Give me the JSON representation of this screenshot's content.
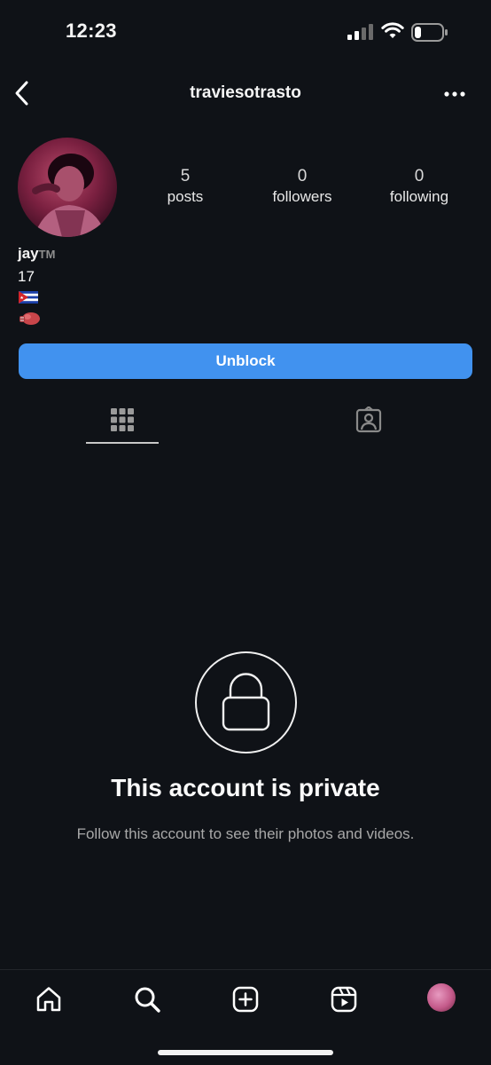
{
  "status_bar": {
    "time": "12:23"
  },
  "header": {
    "username": "traviesotrasto"
  },
  "profile": {
    "stats": [
      {
        "value": "5",
        "label": "posts"
      },
      {
        "value": "0",
        "label": "followers"
      },
      {
        "value": "0",
        "label": "following"
      }
    ],
    "name": "jay",
    "name_suffix": "TM",
    "bio_line1": "17",
    "bio_flag_emoji": "cuba-flag",
    "bio_line3_emoji": "boxing-glove"
  },
  "actions": {
    "unblock_label": "Unblock"
  },
  "tabs": [
    {
      "icon": "grid-icon",
      "selected": true
    },
    {
      "icon": "tagged-icon",
      "selected": false
    }
  ],
  "private": {
    "title": "This account is private",
    "subtitle": "Follow this account to see their photos and videos."
  },
  "bottom_nav": [
    "home-icon",
    "search-icon",
    "create-icon",
    "reels-icon",
    "profile-avatar"
  ],
  "colors": {
    "background": "#0f1217",
    "accent": "#4192ef"
  }
}
